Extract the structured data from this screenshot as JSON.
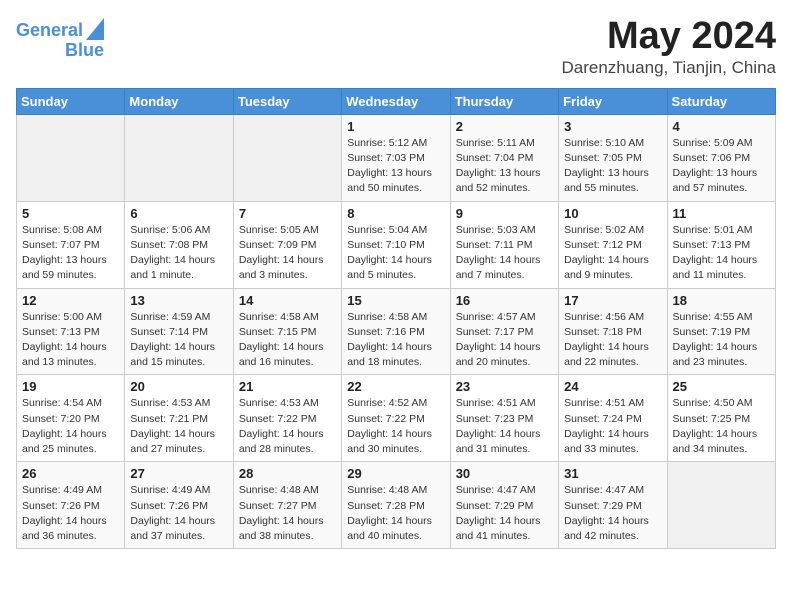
{
  "header": {
    "logo_line1": "General",
    "logo_line2": "Blue",
    "month": "May 2024",
    "location": "Darenzhuang, Tianjin, China"
  },
  "weekdays": [
    "Sunday",
    "Monday",
    "Tuesday",
    "Wednesday",
    "Thursday",
    "Friday",
    "Saturday"
  ],
  "weeks": [
    [
      {
        "day": "",
        "info": ""
      },
      {
        "day": "",
        "info": ""
      },
      {
        "day": "",
        "info": ""
      },
      {
        "day": "1",
        "info": "Sunrise: 5:12 AM\nSunset: 7:03 PM\nDaylight: 13 hours\nand 50 minutes."
      },
      {
        "day": "2",
        "info": "Sunrise: 5:11 AM\nSunset: 7:04 PM\nDaylight: 13 hours\nand 52 minutes."
      },
      {
        "day": "3",
        "info": "Sunrise: 5:10 AM\nSunset: 7:05 PM\nDaylight: 13 hours\nand 55 minutes."
      },
      {
        "day": "4",
        "info": "Sunrise: 5:09 AM\nSunset: 7:06 PM\nDaylight: 13 hours\nand 57 minutes."
      }
    ],
    [
      {
        "day": "5",
        "info": "Sunrise: 5:08 AM\nSunset: 7:07 PM\nDaylight: 13 hours\nand 59 minutes."
      },
      {
        "day": "6",
        "info": "Sunrise: 5:06 AM\nSunset: 7:08 PM\nDaylight: 14 hours\nand 1 minute."
      },
      {
        "day": "7",
        "info": "Sunrise: 5:05 AM\nSunset: 7:09 PM\nDaylight: 14 hours\nand 3 minutes."
      },
      {
        "day": "8",
        "info": "Sunrise: 5:04 AM\nSunset: 7:10 PM\nDaylight: 14 hours\nand 5 minutes."
      },
      {
        "day": "9",
        "info": "Sunrise: 5:03 AM\nSunset: 7:11 PM\nDaylight: 14 hours\nand 7 minutes."
      },
      {
        "day": "10",
        "info": "Sunrise: 5:02 AM\nSunset: 7:12 PM\nDaylight: 14 hours\nand 9 minutes."
      },
      {
        "day": "11",
        "info": "Sunrise: 5:01 AM\nSunset: 7:13 PM\nDaylight: 14 hours\nand 11 minutes."
      }
    ],
    [
      {
        "day": "12",
        "info": "Sunrise: 5:00 AM\nSunset: 7:13 PM\nDaylight: 14 hours\nand 13 minutes."
      },
      {
        "day": "13",
        "info": "Sunrise: 4:59 AM\nSunset: 7:14 PM\nDaylight: 14 hours\nand 15 minutes."
      },
      {
        "day": "14",
        "info": "Sunrise: 4:58 AM\nSunset: 7:15 PM\nDaylight: 14 hours\nand 16 minutes."
      },
      {
        "day": "15",
        "info": "Sunrise: 4:58 AM\nSunset: 7:16 PM\nDaylight: 14 hours\nand 18 minutes."
      },
      {
        "day": "16",
        "info": "Sunrise: 4:57 AM\nSunset: 7:17 PM\nDaylight: 14 hours\nand 20 minutes."
      },
      {
        "day": "17",
        "info": "Sunrise: 4:56 AM\nSunset: 7:18 PM\nDaylight: 14 hours\nand 22 minutes."
      },
      {
        "day": "18",
        "info": "Sunrise: 4:55 AM\nSunset: 7:19 PM\nDaylight: 14 hours\nand 23 minutes."
      }
    ],
    [
      {
        "day": "19",
        "info": "Sunrise: 4:54 AM\nSunset: 7:20 PM\nDaylight: 14 hours\nand 25 minutes."
      },
      {
        "day": "20",
        "info": "Sunrise: 4:53 AM\nSunset: 7:21 PM\nDaylight: 14 hours\nand 27 minutes."
      },
      {
        "day": "21",
        "info": "Sunrise: 4:53 AM\nSunset: 7:22 PM\nDaylight: 14 hours\nand 28 minutes."
      },
      {
        "day": "22",
        "info": "Sunrise: 4:52 AM\nSunset: 7:22 PM\nDaylight: 14 hours\nand 30 minutes."
      },
      {
        "day": "23",
        "info": "Sunrise: 4:51 AM\nSunset: 7:23 PM\nDaylight: 14 hours\nand 31 minutes."
      },
      {
        "day": "24",
        "info": "Sunrise: 4:51 AM\nSunset: 7:24 PM\nDaylight: 14 hours\nand 33 minutes."
      },
      {
        "day": "25",
        "info": "Sunrise: 4:50 AM\nSunset: 7:25 PM\nDaylight: 14 hours\nand 34 minutes."
      }
    ],
    [
      {
        "day": "26",
        "info": "Sunrise: 4:49 AM\nSunset: 7:26 PM\nDaylight: 14 hours\nand 36 minutes."
      },
      {
        "day": "27",
        "info": "Sunrise: 4:49 AM\nSunset: 7:26 PM\nDaylight: 14 hours\nand 37 minutes."
      },
      {
        "day": "28",
        "info": "Sunrise: 4:48 AM\nSunset: 7:27 PM\nDaylight: 14 hours\nand 38 minutes."
      },
      {
        "day": "29",
        "info": "Sunrise: 4:48 AM\nSunset: 7:28 PM\nDaylight: 14 hours\nand 40 minutes."
      },
      {
        "day": "30",
        "info": "Sunrise: 4:47 AM\nSunset: 7:29 PM\nDaylight: 14 hours\nand 41 minutes."
      },
      {
        "day": "31",
        "info": "Sunrise: 4:47 AM\nSunset: 7:29 PM\nDaylight: 14 hours\nand 42 minutes."
      },
      {
        "day": "",
        "info": ""
      }
    ]
  ]
}
